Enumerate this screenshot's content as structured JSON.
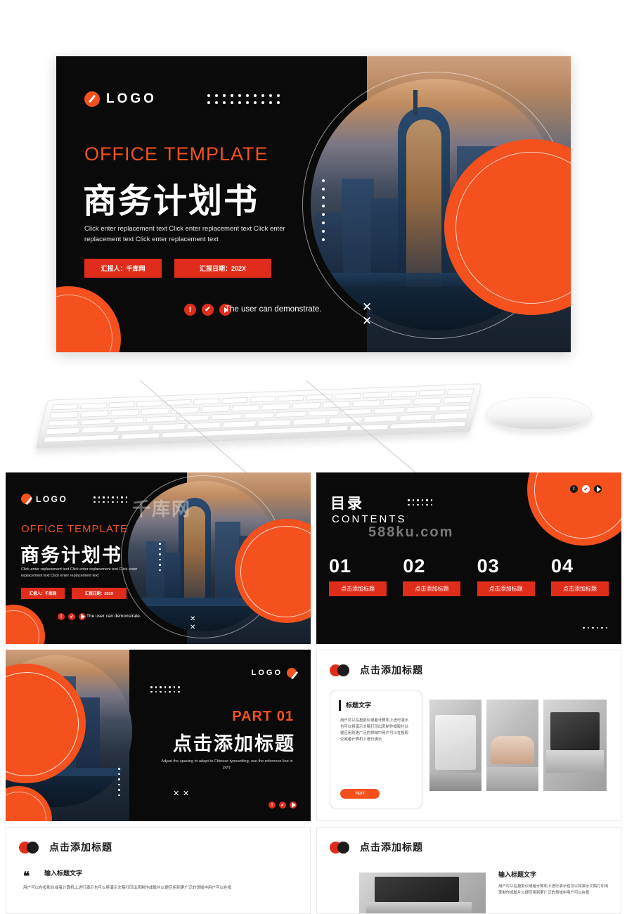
{
  "brand": {
    "accent_orange": "#f4511e",
    "accent_red": "#e02d1b",
    "dark": "#0a0a0a",
    "logo_text": "LOGO"
  },
  "hero": {
    "logo_text": "LOGO",
    "en_title": "OFFICE TEMPLATE",
    "cn_title": "商务计划书",
    "description": "Click enter replacement text Click enter replacement text Click enter replacement text Click enter replacement text",
    "tag_presenter": "汇报人：千库网",
    "tag_date": "汇报日期：202X",
    "footer_text": "The user can demonstrate.",
    "close_icon": "✕"
  },
  "slide1": {
    "logo_text": "LOGO",
    "en_title": "OFFICE TEMPLATE",
    "cn_title": "商务计划书",
    "description": "Click enter replacement text Click enter replacement text Click enter replacement text Click enter replacement text",
    "tag_presenter": "汇报人：千库网",
    "tag_date": "汇报日期：202X",
    "footer_text": "The user can demonstrate.",
    "watermark": "千库网"
  },
  "slide2": {
    "title_cn": "目录",
    "title_en": "CONTENTS",
    "watermark": "588ku.com",
    "items": [
      {
        "num": "01",
        "label": "点击添加标题"
      },
      {
        "num": "02",
        "label": "点击添加标题"
      },
      {
        "num": "03",
        "label": "点击添加标题"
      },
      {
        "num": "04",
        "label": "点击添加标题"
      }
    ]
  },
  "slide3": {
    "logo_text": "LOGO",
    "part": "PART 01",
    "title": "点击添加标题",
    "description": "Adjust the spacing to adapt to Chinese typesetting, use the reference line in PPT."
  },
  "slide4": {
    "header": "点击添加标题",
    "card_title": "标题文字",
    "card_body": "用户可以在投影仪或者计算机上进行演示也可以将演示文稿打印出来制作成胶片以便应用到更广泛的领域中用户可以在投影仪或者计算机上进行演示",
    "button": "TEXT"
  },
  "slide5": {
    "header": "点击添加标题",
    "quote_icon": "❝",
    "sub_title": "输入标题文字",
    "body": "用户可以在投影仪或者计算机上进行演示也可以将演示文稿打印出来制作成胶片以便应用到更广泛的领域中用户可以在投"
  },
  "slide6": {
    "header": "点击添加标题",
    "sub_title": "输入标题文字",
    "body": "用户可以在投影仪或者计算机上进行演示也可以将演示文稿打印出来制作成胶片以便应用到更广泛的领域中用户可以在投"
  }
}
